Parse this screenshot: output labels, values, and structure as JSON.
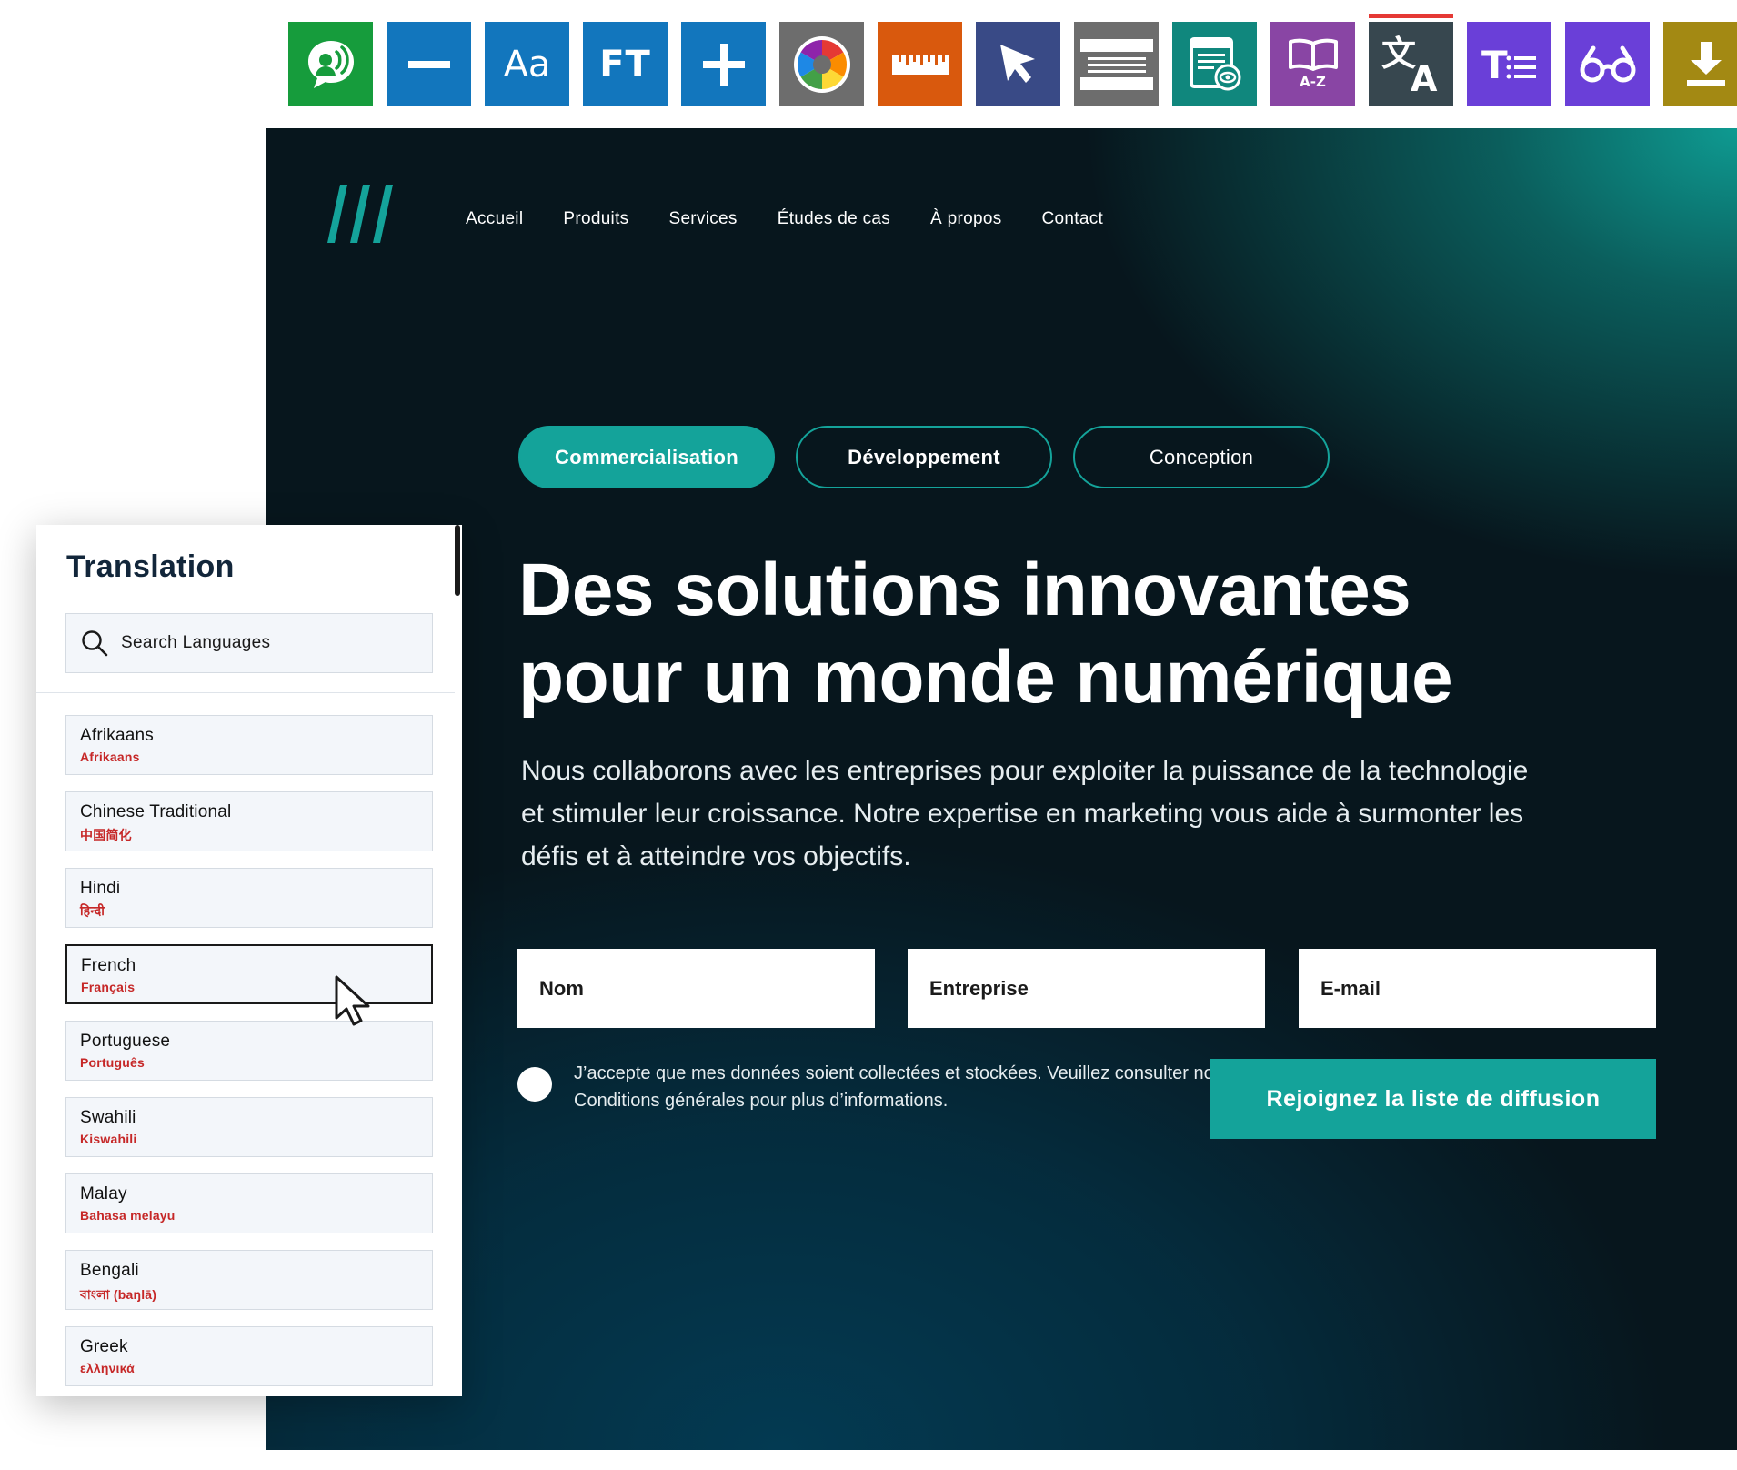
{
  "toolbar": {
    "items": [
      {
        "icon": "speech-icon",
        "color": "#169c3c"
      },
      {
        "icon": "minus-icon",
        "color": "#1276bd"
      },
      {
        "icon": "font-size-icon",
        "color": "#1276bd",
        "label": "Aa"
      },
      {
        "icon": "font-type-icon",
        "color": "#1276bd",
        "label": "FT"
      },
      {
        "icon": "plus-icon",
        "color": "#1276bd"
      },
      {
        "icon": "color-wheel-icon",
        "color": "#6d6d6d"
      },
      {
        "icon": "ruler-icon",
        "color": "#d9590d"
      },
      {
        "icon": "pointer-icon",
        "color": "#394a86"
      },
      {
        "icon": "masking-icon",
        "color": "#6d6d6d"
      },
      {
        "icon": "page-view-icon",
        "color": "#10877d"
      },
      {
        "icon": "dictionary-icon",
        "color": "#8945a4",
        "label": "A-Z"
      },
      {
        "icon": "translate-icon",
        "color": "#37474f",
        "active": true,
        "active_color": "#e53935"
      },
      {
        "icon": "text-extract-icon",
        "color": "#6a3fd8"
      },
      {
        "icon": "reading-glasses-icon",
        "color": "#6a3fd8"
      },
      {
        "icon": "download-icon",
        "color": "#a38913"
      }
    ]
  },
  "hero": {
    "nav": [
      "Accueil",
      "Produits",
      "Services",
      "Études de cas",
      "À propos",
      "Contact"
    ],
    "pills": [
      "Commercialisation",
      "Développement",
      "Conception"
    ],
    "headline_line1": "Des solutions innovantes",
    "headline_line2": "pour un monde numérique",
    "subtext": "Nous collaborons avec les entreprises pour exploiter la puissance de la technologie et stimuler leur croissance. Notre expertise en marketing vous aide à surmonter les défis et à atteindre vos objectifs.",
    "form": {
      "name_placeholder": "Nom",
      "company_placeholder": "Entreprise",
      "email_placeholder": "E-mail",
      "consent": "J’accepte que mes données soient collectées et stockées. Veuillez consulter nos Conditions générales pour plus d’informations.",
      "submit": "Rejoignez la liste de diffusion"
    },
    "accent": "#14a39a"
  },
  "translation": {
    "title": "Translation",
    "search_placeholder": "Search Languages",
    "languages": [
      {
        "name": "Afrikaans",
        "native": "Afrikaans"
      },
      {
        "name": "Chinese Traditional",
        "native": "中国简化"
      },
      {
        "name": "Hindi",
        "native": "हिन्दी"
      },
      {
        "name": "French",
        "native": "Français",
        "selected": true
      },
      {
        "name": "Portuguese",
        "native": "Português"
      },
      {
        "name": "Swahili",
        "native": "Kiswahili"
      },
      {
        "name": "Malay",
        "native": "Bahasa melayu"
      },
      {
        "name": "Bengali",
        "native": "বাংলা (baŋlā)"
      },
      {
        "name": "Greek",
        "native": "ελληνικά"
      }
    ]
  }
}
